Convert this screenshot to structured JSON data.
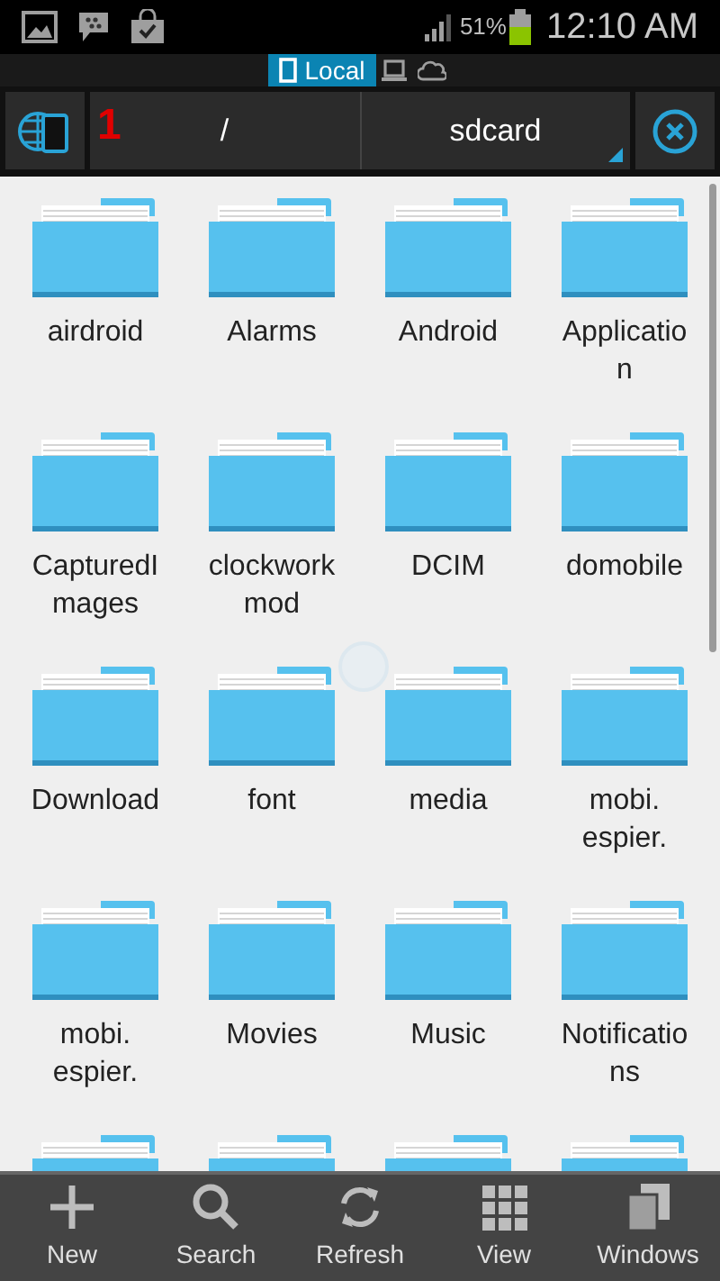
{
  "status_bar": {
    "battery": "51%",
    "time": "12:10 AM"
  },
  "location_tabs": [
    {
      "label": "Local",
      "selected": true,
      "kind": "phone"
    },
    {
      "kind": "computer",
      "selected": false
    },
    {
      "kind": "cloud",
      "selected": false
    }
  ],
  "path_bar": {
    "window_number": "1",
    "segments": [
      "/",
      "sdcard"
    ]
  },
  "folders": [
    {
      "kind": "folder",
      "lines": [
        "airdroid"
      ]
    },
    {
      "kind": "folder",
      "lines": [
        "Alarms"
      ]
    },
    {
      "kind": "folder",
      "lines": [
        "Android"
      ]
    },
    {
      "kind": "folder",
      "lines": [
        "Applicatio",
        "n"
      ]
    },
    {
      "kind": "folder",
      "lines": [
        "CapturedI",
        "mages"
      ]
    },
    {
      "kind": "folder",
      "lines": [
        "clockwork",
        "mod"
      ]
    },
    {
      "kind": "folder",
      "lines": [
        "DCIM"
      ]
    },
    {
      "kind": "folder",
      "lines": [
        "domobile"
      ]
    },
    {
      "kind": "folder",
      "lines": [
        "Download"
      ]
    },
    {
      "kind": "folder",
      "lines": [
        "font"
      ]
    },
    {
      "kind": "folder",
      "lines": [
        "media"
      ]
    },
    {
      "kind": "folder",
      "lines": [
        "mobi.",
        "espier."
      ]
    },
    {
      "kind": "folder",
      "lines": [
        "mobi.",
        "espier."
      ]
    },
    {
      "kind": "folder",
      "lines": [
        "Movies"
      ]
    },
    {
      "kind": "folder",
      "lines": [
        "Music"
      ]
    },
    {
      "kind": "folder",
      "lines": [
        "Notificatio",
        "ns"
      ]
    },
    {
      "kind": "cut_off"
    },
    {
      "kind": "cut_off"
    },
    {
      "kind": "cut_off"
    },
    {
      "kind": "cut_off"
    }
  ],
  "toolbar": [
    {
      "label": "New",
      "kind": "plus"
    },
    {
      "label": "Search",
      "kind": "search"
    },
    {
      "label": "Refresh",
      "kind": "refresh"
    },
    {
      "label": "View",
      "kind": "grid"
    },
    {
      "label": "Windows",
      "kind": "windows"
    }
  ]
}
